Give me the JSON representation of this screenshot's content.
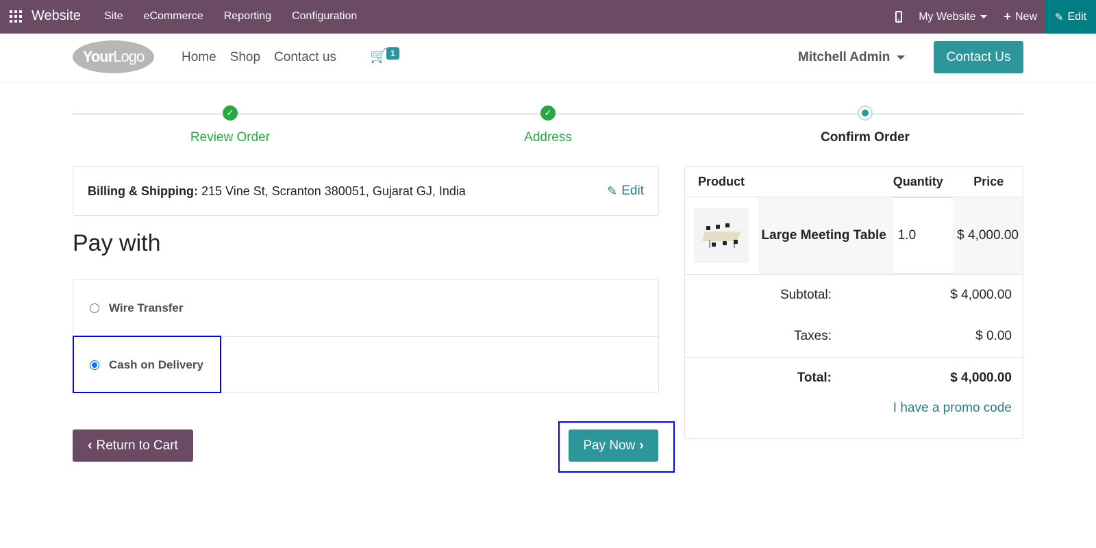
{
  "admin_bar": {
    "brand": "Website",
    "menu": [
      "Site",
      "eCommerce",
      "Reporting",
      "Configuration"
    ],
    "my_website": "My Website",
    "new_label": "New",
    "edit_label": "Edit",
    "bg_color": "#6b4a63",
    "edit_bg_color": "#017e84"
  },
  "header": {
    "logo_text_bold": "Your",
    "logo_text_light": "Logo",
    "nav": [
      "Home",
      "Shop",
      "Contact us"
    ],
    "cart_count": "1",
    "user_name": "Mitchell Admin",
    "contact_button": "Contact Us",
    "accent_color": "#2c969b"
  },
  "steps": [
    {
      "label": "Review Order",
      "state": "done"
    },
    {
      "label": "Address",
      "state": "done"
    },
    {
      "label": "Confirm Order",
      "state": "current"
    }
  ],
  "billing": {
    "label": "Billing & Shipping:",
    "address": "215 Vine St, Scranton 380051, Gujarat GJ, India",
    "edit_label": "Edit"
  },
  "payment": {
    "heading": "Pay with",
    "methods": [
      {
        "label": "Wire Transfer",
        "selected": false
      },
      {
        "label": "Cash on Delivery",
        "selected": true
      }
    ]
  },
  "actions": {
    "return_label": "Return to Cart",
    "pay_label": "Pay Now"
  },
  "summary": {
    "headers": {
      "product": "Product",
      "quantity": "Quantity",
      "price": "Price"
    },
    "items": [
      {
        "name": "Large Meeting Table",
        "quantity": "1.0",
        "price": "$ 4,000.00"
      }
    ],
    "subtotal_label": "Subtotal:",
    "subtotal": "$ 4,000.00",
    "taxes_label": "Taxes:",
    "taxes": "$ 0.00",
    "total_label": "Total:",
    "total": "$ 4,000.00",
    "promo_link": "I have a promo code"
  }
}
